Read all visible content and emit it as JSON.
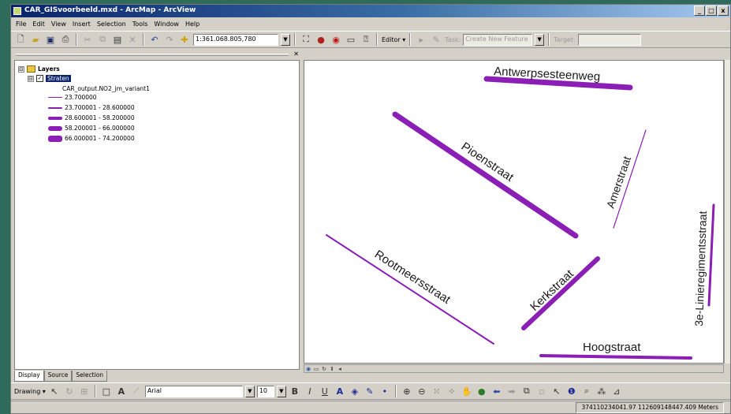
{
  "app": {
    "title": "CAR_GISvoorbeeld.mxd - ArcMap - ArcView",
    "window_controls": {
      "minimize": "_",
      "maximize": "□",
      "close": "x"
    }
  },
  "menu": [
    "File",
    "Edit",
    "View",
    "Insert",
    "Selection",
    "Tools",
    "Window",
    "Help"
  ],
  "standard_toolbar": {
    "scale_value": "1:361.068.805,780",
    "editor_label": "Editor ▾",
    "task_label": "Task:",
    "task_value": "Create New Feature",
    "target_label": "Target:",
    "target_value": ""
  },
  "toc": {
    "root_label": "Layers",
    "layer_label": "Straten",
    "field_label": "CAR_output.NO2_jm_variant1",
    "legend": [
      {
        "label": "23.700000",
        "thickness": 1
      },
      {
        "label": "23.700001 - 28.600000",
        "thickness": 2
      },
      {
        "label": "28.600001 - 58.200000",
        "thickness": 4
      },
      {
        "label": "58.200001 - 66.000000",
        "thickness": 6
      },
      {
        "label": "66.000001 - 74.200000",
        "thickness": 8
      }
    ],
    "tabs": [
      "Display",
      "Source",
      "Selection"
    ],
    "expander_symbol": "⊟",
    "check_symbol": "✓"
  },
  "map": {
    "line_color": "#8b1fb5",
    "streets": [
      {
        "name": "Antwerpsesteenweg"
      },
      {
        "name": "Pioenstraat"
      },
      {
        "name": "Amerstraat"
      },
      {
        "name": "3e-Linieregimentsstraat"
      },
      {
        "name": "Rootmeersstraat"
      },
      {
        "name": "Kerkstraat"
      },
      {
        "name": "Hoogstraat"
      }
    ]
  },
  "drawing_toolbar": {
    "drawing_label": "Drawing ▾",
    "font_value": "Arial",
    "font_size_value": "10"
  },
  "status": {
    "coordinates": "374110234041.97  112609148447.409 Meters"
  }
}
